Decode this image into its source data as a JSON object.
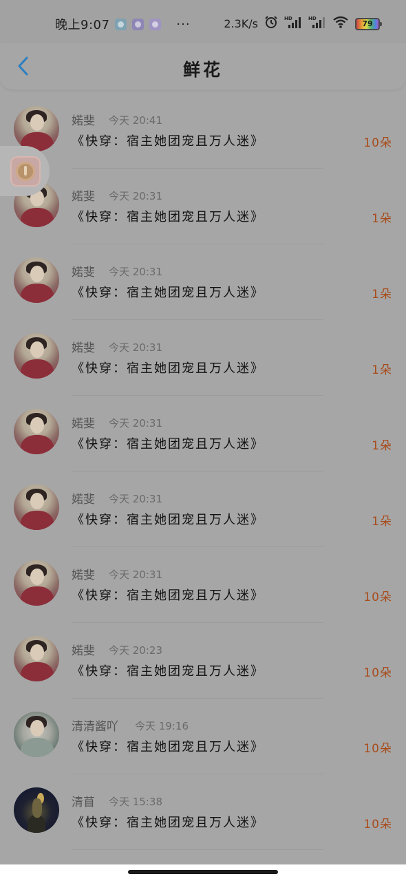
{
  "status_bar": {
    "time": "晚上9:07",
    "more": "···",
    "net_speed": "2.3K/s",
    "battery": "79",
    "icons": [
      "notification-app-icon",
      "notification-app-icon",
      "notification-app-icon",
      "alarm-icon",
      "signal-hd-icon",
      "signal-hd-icon",
      "wifi-icon",
      "battery-icon"
    ]
  },
  "header": {
    "title": "鲜花",
    "back_icon": "chevron-left-icon",
    "accent_color": "#2d7fc0"
  },
  "gifts": [
    {
      "sender": "婼斐",
      "time": "今天 20:41",
      "book": "《快穿：宿主她团宠且万人迷》",
      "count": "10朵",
      "avatar": "a"
    },
    {
      "sender": "婼斐",
      "time": "今天 20:31",
      "book": "《快穿：宿主她团宠且万人迷》",
      "count": "1朵",
      "avatar": "a"
    },
    {
      "sender": "婼斐",
      "time": "今天 20:31",
      "book": "《快穿：宿主她团宠且万人迷》",
      "count": "1朵",
      "avatar": "a"
    },
    {
      "sender": "婼斐",
      "time": "今天 20:31",
      "book": "《快穿：宿主她团宠且万人迷》",
      "count": "1朵",
      "avatar": "a"
    },
    {
      "sender": "婼斐",
      "time": "今天 20:31",
      "book": "《快穿：宿主她团宠且万人迷》",
      "count": "1朵",
      "avatar": "a"
    },
    {
      "sender": "婼斐",
      "time": "今天 20:31",
      "book": "《快穿：宿主她团宠且万人迷》",
      "count": "1朵",
      "avatar": "a"
    },
    {
      "sender": "婼斐",
      "time": "今天 20:31",
      "book": "《快穿：宿主她团宠且万人迷》",
      "count": "10朵",
      "avatar": "a"
    },
    {
      "sender": "婼斐",
      "time": "今天 20:23",
      "book": "《快穿：宿主她团宠且万人迷》",
      "count": "10朵",
      "avatar": "a"
    },
    {
      "sender": "清清酱吖",
      "time": "今天 19:16",
      "book": "《快穿：宿主她团宠且万人迷》",
      "count": "10朵",
      "avatar": "b"
    },
    {
      "sender": "清苜",
      "time": "今天 15:38",
      "book": "《快穿：宿主她团宠且万人迷》",
      "count": "10朵",
      "avatar": "c"
    }
  ],
  "floating_button": {
    "icon": "floating-app-icon"
  },
  "colors": {
    "overlay": "#a6a6a6",
    "count_color": "#a84c1c"
  }
}
